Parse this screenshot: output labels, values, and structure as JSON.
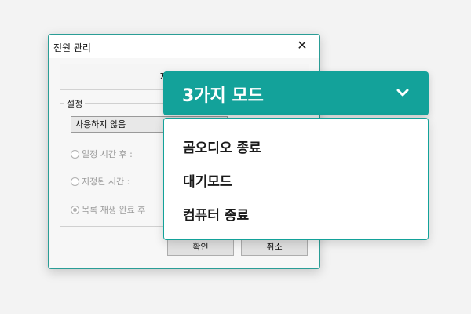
{
  "dialog": {
    "title": "전원 관리",
    "close_glyph": "✕",
    "info_text": "자동 종료 시",
    "group_label": "설정",
    "select_value": "사용하지 않음",
    "options": [
      {
        "label": "일정 시간 후 :",
        "checked": false
      },
      {
        "label": "지정된 시간 :",
        "checked": false
      },
      {
        "label": "목록 재생 완료 후",
        "checked": true
      }
    ],
    "ok_label": "확인",
    "cancel_label": "취소"
  },
  "dropdown": {
    "header_label": "3가지 모드",
    "chevron_icon": "chevron-down-icon",
    "items": [
      "곰오디오 종료",
      "대기모드",
      "컴퓨터 종료"
    ]
  },
  "colors": {
    "accent": "#13a29a",
    "dialog_border": "#2a9d96"
  }
}
